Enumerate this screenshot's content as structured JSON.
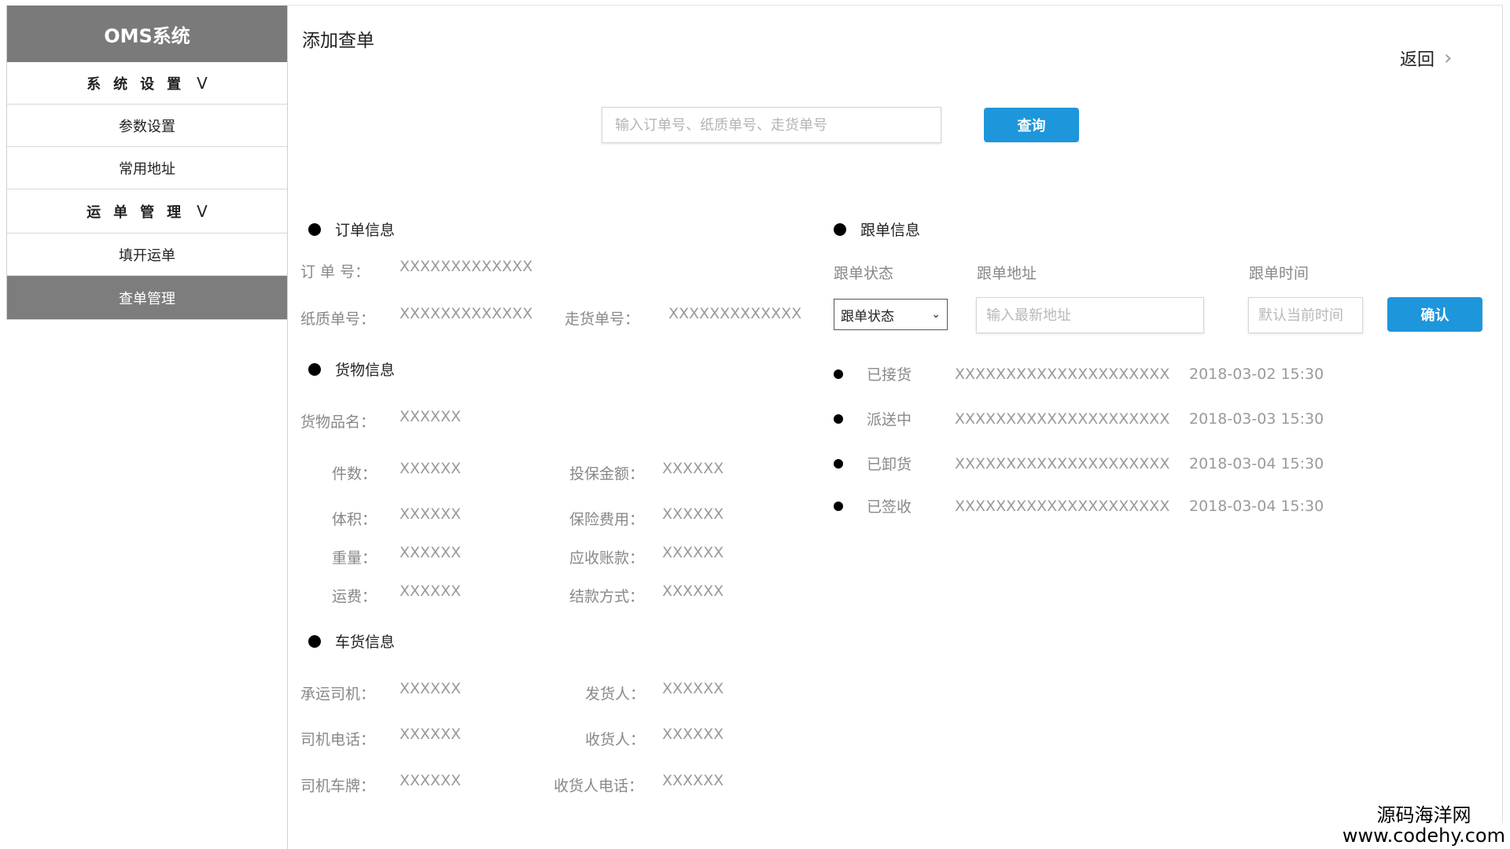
{
  "sidebar": {
    "logo": "OMS系统",
    "items": [
      {
        "label": "系统设置",
        "chevron": "V"
      },
      {
        "label": "参数设置"
      },
      {
        "label": "常用地址"
      },
      {
        "label": "运单管理",
        "chevron": "V"
      },
      {
        "label": "填开运单"
      },
      {
        "label": "查单管理"
      }
    ]
  },
  "header": {
    "title": "添加查单",
    "back_label": "返回",
    "back_icon": "chevron-right-icon"
  },
  "search": {
    "placeholder": "输入订单号、纸质单号、走货单号",
    "button_label": "查询"
  },
  "order_info": {
    "title": "订单信息",
    "order_no_label": "订 单 号：",
    "order_no": "XXXXXXXXXXXXX",
    "paper_no_label": "纸质单号：",
    "paper_no": "XXXXXXXXXXXXX",
    "freight_no_label": "走货单号：",
    "freight_no": "XXXXXXXXXXXXX"
  },
  "goods_info": {
    "title": "货物信息",
    "fields": [
      {
        "label": "货物品名：",
        "value": "XXXXXX"
      },
      {
        "label": "件数：",
        "value": "XXXXXX"
      },
      {
        "label": "投保金额：",
        "value": "XXXXXX"
      },
      {
        "label": "体积：",
        "value": "XXXXXX"
      },
      {
        "label": "保险费用：",
        "value": "XXXXXX"
      },
      {
        "label": "重量：",
        "value": "XXXXXX"
      },
      {
        "label": "应收账款：",
        "value": "XXXXXX"
      },
      {
        "label": "运费：",
        "value": "XXXXXX"
      },
      {
        "label": "结款方式：",
        "value": "XXXXXX"
      }
    ]
  },
  "vehicle_info": {
    "title": "车货信息",
    "fields": [
      {
        "label": "承运司机：",
        "value": "XXXXXX"
      },
      {
        "label": "发货人：",
        "value": "XXXXXX"
      },
      {
        "label": "司机电话：",
        "value": "XXXXXX"
      },
      {
        "label": "收货人：",
        "value": "XXXXXX"
      },
      {
        "label": "司机车牌：",
        "value": "XXXXXX"
      },
      {
        "label": "收货人电话：",
        "value": "XXXXXX"
      }
    ]
  },
  "tracking": {
    "title": "跟单信息",
    "col_status": "跟单状态",
    "col_address": "跟单地址",
    "col_time": "跟单时间",
    "status_select_value": "跟单状态",
    "address_placeholder": "输入最新地址",
    "time_placeholder": "默认当前时间",
    "confirm_label": "确认",
    "rows": [
      {
        "status": "已接货",
        "address": "XXXXXXXXXXXXXXXXXXXXX",
        "time": "2018-03-02 15:30"
      },
      {
        "status": "派送中",
        "address": "XXXXXXXXXXXXXXXXXXXXX",
        "time": "2018-03-03 15:30"
      },
      {
        "status": "已卸货",
        "address": "XXXXXXXXXXXXXXXXXXXXX",
        "time": "2018-03-04 15:30"
      },
      {
        "status": "已签收",
        "address": "XXXXXXXXXXXXXXXXXXXXX",
        "time": "2018-03-04 15:30"
      }
    ]
  },
  "watermark": {
    "line1": "源码海洋网",
    "line2": "www.codehy.com"
  }
}
